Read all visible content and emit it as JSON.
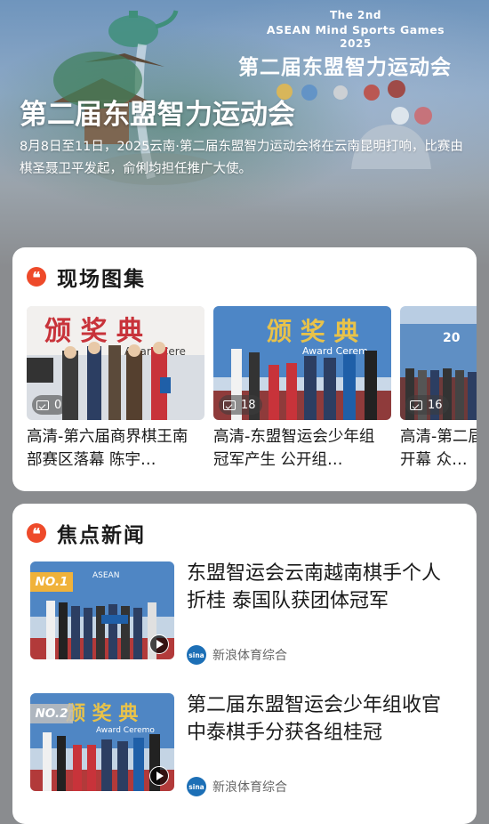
{
  "hero": {
    "en_line1": "The 2nd",
    "en_line2": "ASEAN Mind Sports Games",
    "en_line3": "2025",
    "banner_cn": "第二届东盟智力运动会",
    "title": "第二届东盟智力运动会",
    "description": "8月8日至11日，2025云南·第二届东盟智力运动会将在云南昆明打响，比赛由棋圣聂卫平发起，俞俐均担任推广大使。"
  },
  "gallery": {
    "title": "现场图集",
    "items": [
      {
        "count": "0",
        "caption": "高清-第六届商界棋王南部赛区落幕 陈宇…"
      },
      {
        "count": "18",
        "caption": "高清-东盟智运会少年组冠军产生 公开组…"
      },
      {
        "count": "16",
        "caption": "高清-第二届东盟智运会开幕 众…"
      }
    ]
  },
  "news": {
    "title": "焦点新闻",
    "items": [
      {
        "rank": "NO.1",
        "title": "东盟智运会云南越南棋手个人折桂 泰国队获团体冠军",
        "source": "新浪体育综合",
        "logo": "sina"
      },
      {
        "rank": "NO.2",
        "title": "第二届东盟智运会少年组收官 中泰棋手分获各组桂冠",
        "source": "新浪体育综合",
        "logo": "sina"
      }
    ]
  },
  "colors": {
    "accent": "#ee4a2a",
    "rank_gold": "#f0b23a",
    "stage_red": "#c8333a",
    "stage_blue": "#1f5fa8"
  }
}
